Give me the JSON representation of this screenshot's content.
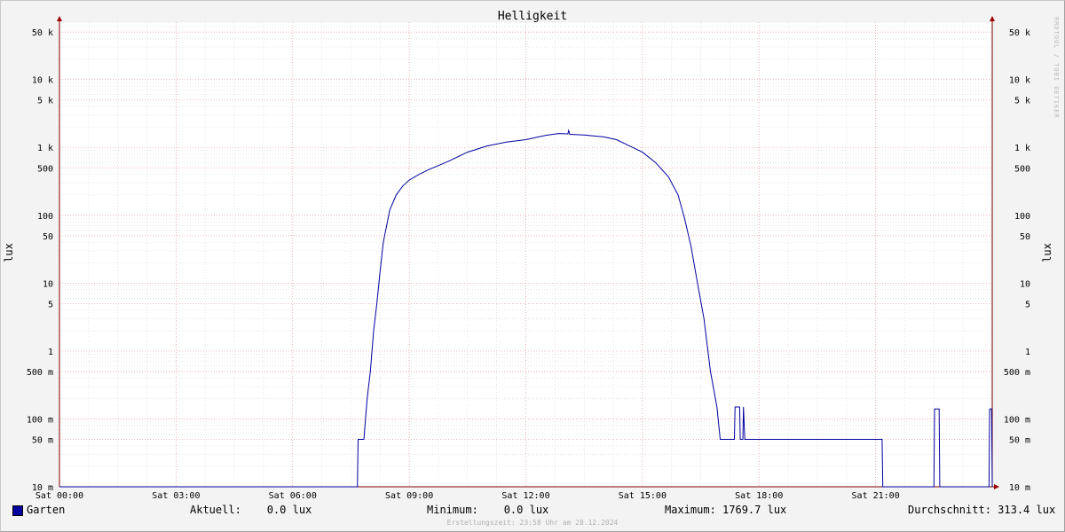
{
  "chart_data": {
    "type": "line",
    "title": "Helligkeit",
    "ylabel": "lux",
    "y_scale": "log",
    "ylim": [
      0.01,
      70000
    ],
    "y_ticks": [
      {
        "value": 0.01,
        "label": "10 m"
      },
      {
        "value": 0.05,
        "label": "50 m"
      },
      {
        "value": 0.1,
        "label": "100 m"
      },
      {
        "value": 0.5,
        "label": "500 m"
      },
      {
        "value": 1,
        "label": "1"
      },
      {
        "value": 5,
        "label": "5"
      },
      {
        "value": 10,
        "label": "10"
      },
      {
        "value": 50,
        "label": "50"
      },
      {
        "value": 100,
        "label": "100"
      },
      {
        "value": 500,
        "label": "500"
      },
      {
        "value": 1000,
        "label": "1 k"
      },
      {
        "value": 5000,
        "label": "5 k"
      },
      {
        "value": 10000,
        "label": "10 k"
      },
      {
        "value": 50000,
        "label": "50 k"
      }
    ],
    "x_ticks": [
      "Sat 00:00",
      "Sat 03:00",
      "Sat 06:00",
      "Sat 09:00",
      "Sat 12:00",
      "Sat 15:00",
      "Sat 18:00",
      "Sat 21:00"
    ],
    "series": [
      {
        "name": "Garten",
        "color": "#0000a0",
        "points": [
          [
            "00:00",
            0.01
          ],
          [
            "07:40",
            0.01
          ],
          [
            "07:41",
            0.05
          ],
          [
            "07:50",
            0.05
          ],
          [
            "07:55",
            0.2
          ],
          [
            "08:00",
            0.5
          ],
          [
            "08:05",
            2
          ],
          [
            "08:10",
            5
          ],
          [
            "08:15",
            15
          ],
          [
            "08:20",
            40
          ],
          [
            "08:25",
            70
          ],
          [
            "08:30",
            120
          ],
          [
            "08:40",
            200
          ],
          [
            "08:50",
            270
          ],
          [
            "09:00",
            330
          ],
          [
            "09:15",
            400
          ],
          [
            "09:30",
            470
          ],
          [
            "10:00",
            620
          ],
          [
            "10:30",
            850
          ],
          [
            "11:00",
            1050
          ],
          [
            "11:30",
            1200
          ],
          [
            "12:00",
            1300
          ],
          [
            "12:30",
            1500
          ],
          [
            "12:50",
            1600
          ],
          [
            "13:05",
            1580
          ],
          [
            "13:06",
            1769.7
          ],
          [
            "13:08",
            1560
          ],
          [
            "13:30",
            1520
          ],
          [
            "14:00",
            1430
          ],
          [
            "14:20",
            1300
          ],
          [
            "14:40",
            1050
          ],
          [
            "15:00",
            850
          ],
          [
            "15:20",
            600
          ],
          [
            "15:40",
            370
          ],
          [
            "15:55",
            200
          ],
          [
            "16:05",
            90
          ],
          [
            "16:15",
            35
          ],
          [
            "16:25",
            10
          ],
          [
            "16:35",
            3
          ],
          [
            "16:45",
            0.5
          ],
          [
            "16:55",
            0.15
          ],
          [
            "17:00",
            0.05
          ],
          [
            "17:22",
            0.05
          ],
          [
            "17:23",
            0.15
          ],
          [
            "17:30",
            0.15
          ],
          [
            "17:31",
            0.05
          ],
          [
            "17:35",
            0.05
          ],
          [
            "17:36",
            0.15
          ],
          [
            "17:38",
            0.05
          ],
          [
            "21:00",
            0.05
          ],
          [
            "21:10",
            0.05
          ],
          [
            "21:11",
            0.01
          ],
          [
            "22:30",
            0.01
          ],
          [
            "22:31",
            0.14
          ],
          [
            "22:38",
            0.14
          ],
          [
            "22:39",
            0.01
          ],
          [
            "23:55",
            0.01
          ],
          [
            "23:56",
            0.14
          ],
          [
            "23:59",
            0.14
          ],
          [
            "24:00",
            0.01
          ]
        ]
      }
    ]
  },
  "legend": {
    "series_name": "Garten",
    "current": "Aktuell:    0.0 lux",
    "minimum": "Minimum:    0.0 lux",
    "maximum": "Maximum: 1769.7 lux",
    "average": "Durchschnitt: 313.4 lux"
  },
  "watermark": "RRDTOOL / TOBI OETIKER",
  "footer": "Erstellungszeit: 23:58 Uhr am 28.12.2024",
  "colors": {
    "line": "#0000a0",
    "major_grid": "#e8a0a0",
    "minor_grid": "#d8d8d8",
    "axis": "#800000"
  }
}
